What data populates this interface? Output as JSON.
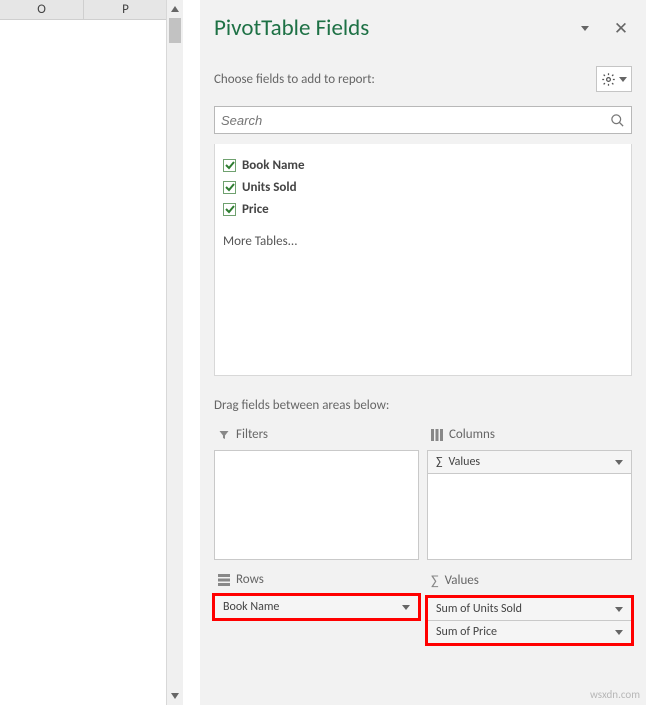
{
  "worksheet": {
    "columns": [
      "O",
      "P"
    ]
  },
  "pane": {
    "title": "PivotTable Fields",
    "instruction": "Choose fields to add to report:",
    "search_placeholder": "Search",
    "fields": [
      {
        "label": "Book Name",
        "checked": true
      },
      {
        "label": "Units Sold",
        "checked": true
      },
      {
        "label": "Price",
        "checked": true
      }
    ],
    "more_tables": "More Tables...",
    "drag_text": "Drag fields between areas below:",
    "areas": {
      "filters": {
        "label": "Filters",
        "items": []
      },
      "columns": {
        "label": "Columns",
        "items": [
          {
            "label": "Values",
            "sigma": true
          }
        ]
      },
      "rows": {
        "label": "Rows",
        "items": [
          {
            "label": "Book Name"
          }
        ]
      },
      "values": {
        "label": "Values",
        "items": [
          {
            "label": "Sum of Units Sold"
          },
          {
            "label": "Sum of Price"
          }
        ]
      }
    }
  },
  "watermark": "wsxdn.com"
}
